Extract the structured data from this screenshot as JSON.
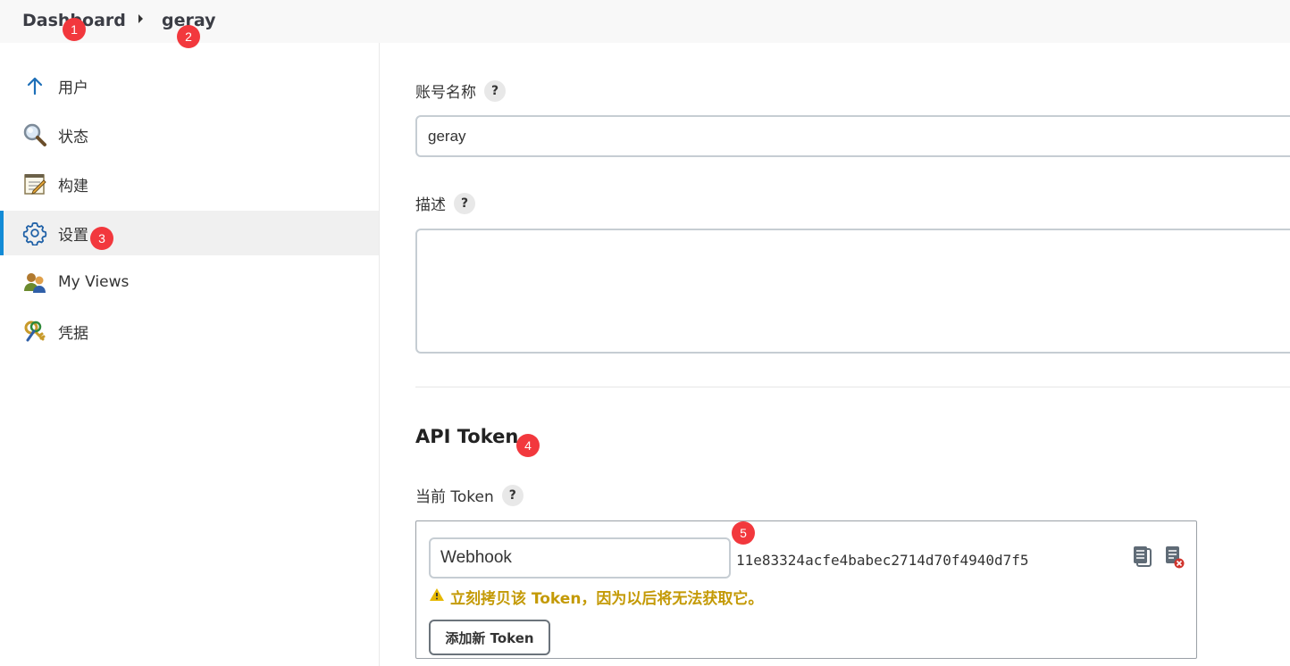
{
  "breadcrumb": {
    "items": [
      {
        "label": "Dashboard"
      },
      {
        "label": "geray"
      }
    ]
  },
  "annotations": [
    "1",
    "2",
    "3",
    "4",
    "5"
  ],
  "sidebar": {
    "items": [
      {
        "label": "用户",
        "icon": "arrow-up-icon"
      },
      {
        "label": "状态",
        "icon": "magnifier-icon"
      },
      {
        "label": "构建",
        "icon": "notepad-icon"
      },
      {
        "label": "设置",
        "icon": "gear-icon",
        "active": true
      },
      {
        "label": "My Views",
        "icon": "users-icon"
      },
      {
        "label": "凭据",
        "icon": "keys-icon"
      }
    ]
  },
  "form": {
    "account_label": "账号名称",
    "account_value": "geray",
    "description_label": "描述",
    "description_value": "",
    "help_glyph": "?"
  },
  "api_token": {
    "section_title": "API Token",
    "current_label": "当前 Token",
    "token_name": "Webhook",
    "token_value": "11e83324acfe4babec2714d70f4940d7f5",
    "warning": "立刻拷贝该 Token，因为以后将无法获取它。",
    "add_button": "添加新 Token"
  },
  "colors": {
    "accent": "#138bd6",
    "badge": "#f2383d",
    "warning": "#c49a06"
  }
}
